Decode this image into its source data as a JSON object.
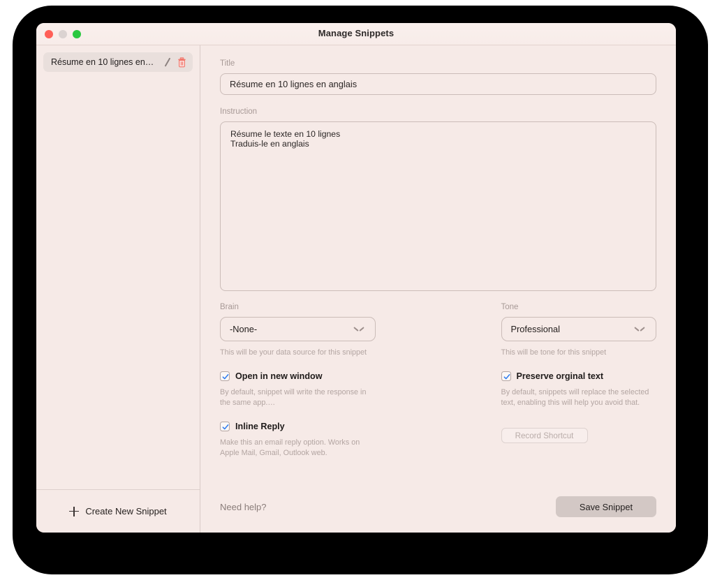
{
  "window": {
    "title": "Manage Snippets",
    "traffic_lights": [
      "close",
      "minimize",
      "zoom"
    ]
  },
  "sidebar": {
    "snippets": [
      {
        "title": "Résume en 10 lignes en…",
        "edit_icon": "pencil-icon",
        "delete_icon": "trash-icon",
        "selected": true
      }
    ],
    "create_button": {
      "label": "Create New Snippet",
      "icon": "plus-icon"
    }
  },
  "form": {
    "title": {
      "label": "Title",
      "value": "Résume en 10 lignes en anglais",
      "placeholder": "Title"
    },
    "instruction": {
      "label": "Instruction",
      "value": "Résume le texte en 10 lignes\nTraduis-le en anglais",
      "placeholder": "Instruction"
    },
    "brain": {
      "label": "Brain",
      "value": "-None-",
      "options": [
        "-None-"
      ],
      "hint": "This will be your data source for this snippet",
      "chevron_icon": "chevron-down-icon"
    },
    "tone": {
      "label": "Tone",
      "value": "Professional",
      "options": [
        "Professional"
      ],
      "hint": "This will be tone for this snippet",
      "chevron_icon": "chevron-down-icon"
    },
    "open_in_new_window": {
      "label": "Open in new window",
      "checked": true,
      "hint": "By default, snippet will write the response in the same app.…"
    },
    "inline_reply": {
      "label": "Inline Reply",
      "checked": true,
      "hint": "Make this an email reply option. Works on Apple Mail, Gmail, Outlook web."
    },
    "preserve_original_text": {
      "label": "Preserve orginal text",
      "checked": true,
      "hint": "By default, snippets will replace the selected text, enabling this will help you avoid that."
    },
    "record_shortcut": {
      "label": "Record Shortcut",
      "enabled": false
    }
  },
  "footer": {
    "need_help": "Need help?",
    "save_label": "Save Snippet"
  },
  "colors": {
    "background": "#f6eae7",
    "accent_checkmark": "#2d7bf0",
    "trash": "#f2766b",
    "save_button": "#d3c8c5",
    "traffic_close": "#ff5f57",
    "traffic_min": "#dbd3d1",
    "traffic_zoom": "#2ac840"
  }
}
